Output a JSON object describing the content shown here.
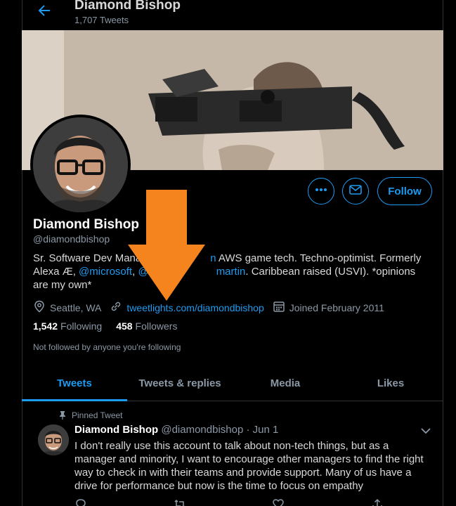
{
  "header": {
    "title": "Diamond Bishop",
    "tweet_count": "1,707 Tweets"
  },
  "profile": {
    "name": "Diamond Bishop",
    "handle": "@diamondbishop",
    "bio_parts": [
      "Sr. Software Dev Mana",
      "n",
      " AWS game tech. Techno-optimist. Formerly Alexa Æ, ",
      "@microsoft",
      ", ",
      "@",
      "martin",
      ". Caribbean raised (USVI). *opinions are my own*"
    ],
    "location": "Seattle, WA",
    "url": "tweetlights.com/diamondbishop",
    "joined": "Joined February 2011",
    "following_count": "1,542",
    "following_label": "Following",
    "followers_count": "458",
    "followers_label": "Followers",
    "not_followed": "Not followed by anyone you're following"
  },
  "buttons": {
    "follow": "Follow"
  },
  "tabs": [
    {
      "label": "Tweets",
      "active": true
    },
    {
      "label": "Tweets & replies",
      "active": false
    },
    {
      "label": "Media",
      "active": false
    },
    {
      "label": "Likes",
      "active": false
    }
  ],
  "tweet": {
    "pinned_label": "Pinned Tweet",
    "author": "Diamond Bishop",
    "handle": "@diamondbishop",
    "sep": "·",
    "date": "Jun 1",
    "text": "I don't really use this account to talk about non-tech things, but as a manager and minority, I want to encourage other managers to find the right way to check in with their teams and provide support. Many of us have a drive for performance but now is the time to focus on empathy"
  },
  "colors": {
    "accent": "#1d9bf0",
    "arrow": "#f5841f",
    "background": "#000000"
  }
}
